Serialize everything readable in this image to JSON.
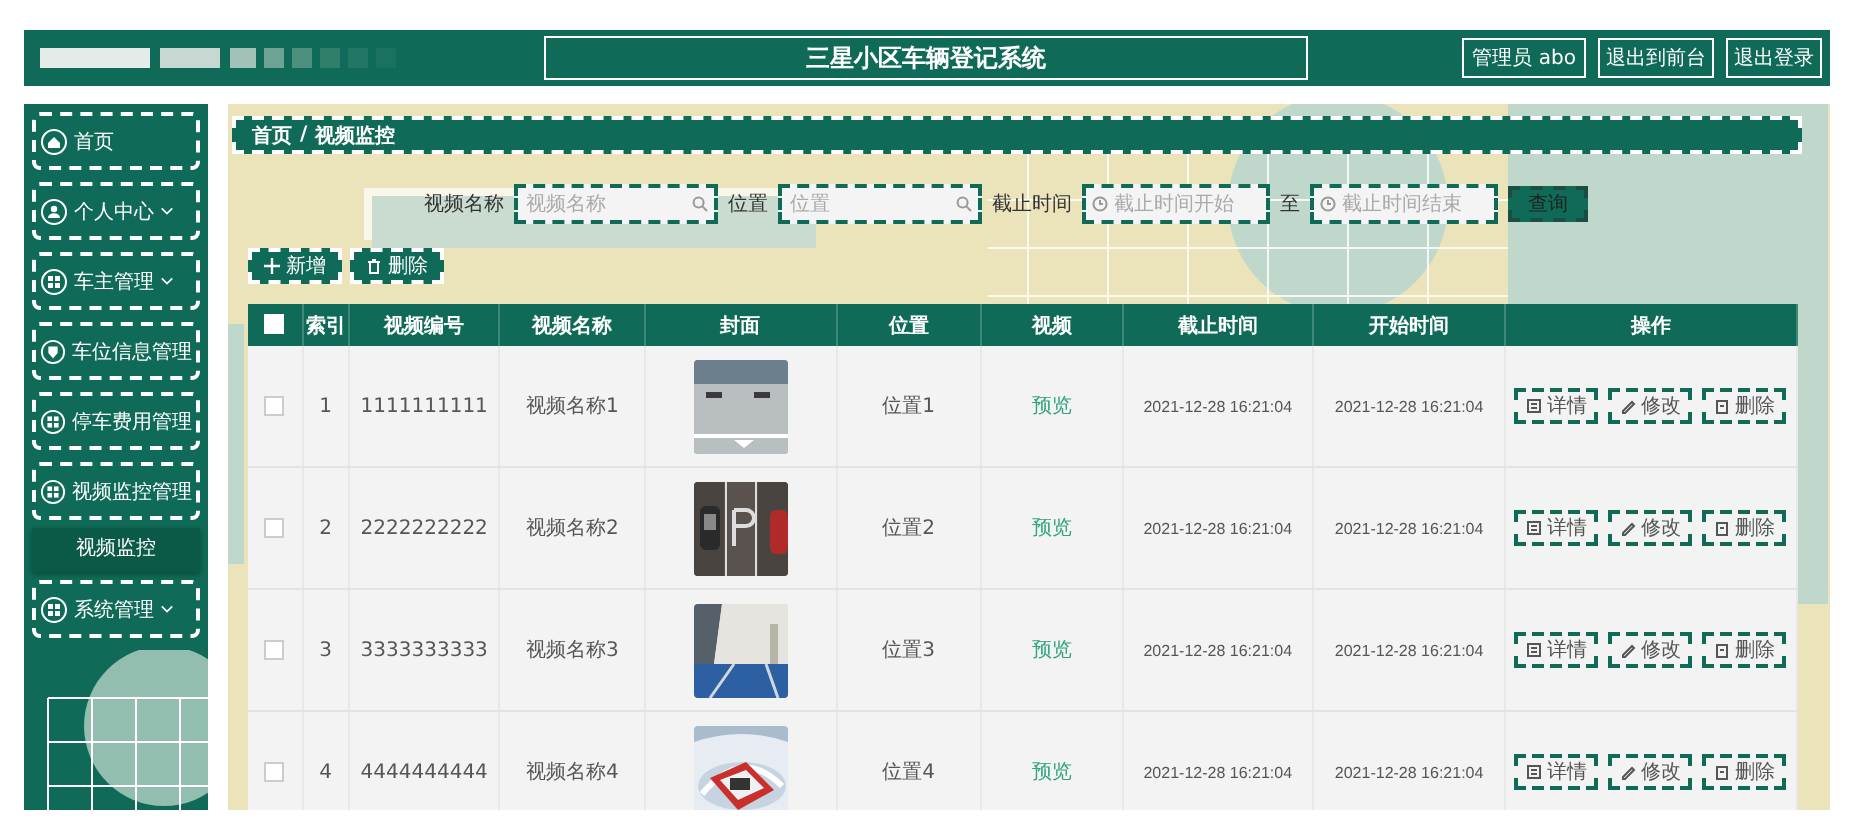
{
  "header": {
    "title": "三星小区车辆登记系统",
    "user": "管理员 abo",
    "links": [
      "退出到前台",
      "退出登录"
    ]
  },
  "sidebar": {
    "items": [
      {
        "label": "首页",
        "kind": "link",
        "selected": false
      },
      {
        "label": "个人中心",
        "kind": "submenu",
        "selected": false
      },
      {
        "label": "车主管理",
        "kind": "submenu",
        "selected": false
      },
      {
        "label": "车位信息管理",
        "kind": "link",
        "selected": false
      },
      {
        "label": "停车费用管理",
        "kind": "link",
        "selected": false
      },
      {
        "label": "视频监控管理",
        "kind": "link",
        "selected": false,
        "children": [
          {
            "label": "视频监控",
            "selected": true
          }
        ]
      },
      {
        "label": "系统管理",
        "kind": "submenu",
        "selected": false
      }
    ]
  },
  "breadcrumb": {
    "items": [
      "首页",
      "视频监控"
    ],
    "separator": "/"
  },
  "search": {
    "fields": [
      {
        "kind": "text",
        "label": "视频名称",
        "placeholder": "视频名称"
      },
      {
        "kind": "text",
        "label": "位置",
        "placeholder": "位置"
      },
      {
        "kind": "daterange",
        "label": "截止时间",
        "placeholder_start": "截止时间开始",
        "separator": "至",
        "placeholder_end": "截止时间结束"
      }
    ],
    "button": "查询"
  },
  "actions": [
    {
      "kind": "add",
      "label": "新增"
    },
    {
      "kind": "delete",
      "label": "删除"
    }
  ],
  "table": {
    "select_all": {
      "checked": false
    },
    "columns": [
      "索引",
      "视频编号",
      "视频名称",
      "封面",
      "位置",
      "视频",
      "截止时间",
      "开始时间",
      "操作"
    ],
    "rows": [
      {
        "checked": false,
        "index": "1",
        "code": "1111111111",
        "name": "视频名称1",
        "location": "位置1",
        "video": "预览",
        "end_time": "2021-12-28 16:21:04",
        "start_time": "2021-12-28 16:21:04",
        "actions": [
          "详情",
          "修改",
          "删除"
        ]
      },
      {
        "checked": false,
        "index": "2",
        "code": "2222222222",
        "name": "视频名称2",
        "location": "位置2",
        "video": "预览",
        "end_time": "2021-12-28 16:21:04",
        "start_time": "2021-12-28 16:21:04",
        "actions": [
          "详情",
          "修改",
          "删除"
        ]
      },
      {
        "checked": false,
        "index": "3",
        "code": "3333333333",
        "name": "视频名称3",
        "location": "位置3",
        "video": "预览",
        "end_time": "2021-12-28 16:21:04",
        "start_time": "2021-12-28 16:21:04",
        "actions": [
          "详情",
          "修改",
          "删除"
        ]
      },
      {
        "checked": false,
        "index": "4",
        "code": "4444444444",
        "name": "视频名称4",
        "location": "位置4",
        "video": "预览",
        "end_time": "2021-12-28 16:21:04",
        "start_time": "2021-12-28 16:21:04",
        "actions": [
          "详情",
          "修改",
          "删除"
        ]
      }
    ]
  }
}
